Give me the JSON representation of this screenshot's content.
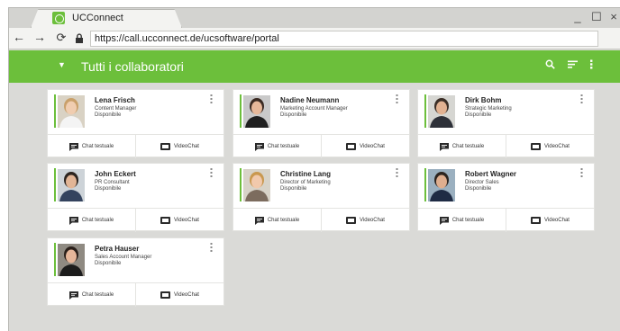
{
  "browser": {
    "tab_title": "UCConnect",
    "url": "https://call.ucconnect.de/ucsoftware/portal",
    "controls": {
      "minimize": "_",
      "maximize": "☐",
      "close": "×"
    },
    "nav": {
      "back": "←",
      "forward": "→",
      "reload": "⟳"
    }
  },
  "appbar": {
    "title": "Tutti i collaboratori",
    "color": "#6cbf3b",
    "icons": [
      "search-icon",
      "filter-icon",
      "more-vertical-icon"
    ]
  },
  "contacts": [
    {
      "name": "Lena Frisch",
      "role": "Content Manager",
      "status": "Disponibile",
      "chat_label": "Chat testuale",
      "video_label": "VideoChat"
    },
    {
      "name": "Nadine Neumann",
      "role": "Marketing Account Manager",
      "status": "Disponibile",
      "chat_label": "Chat testuale",
      "video_label": "VideoChat"
    },
    {
      "name": "Dirk Bohm",
      "role": "Strategic Marketing",
      "status": "Disponibile",
      "chat_label": "Chat testuale",
      "video_label": "VideoChat"
    },
    {
      "name": "John Eckert",
      "role": "PR Consultant",
      "status": "Disponibile",
      "chat_label": "Chat testuale",
      "video_label": "VideoChat"
    },
    {
      "name": "Christine Lang",
      "role": "Director of Marketing",
      "status": "Disponibile",
      "chat_label": "Chat testuale",
      "video_label": "VideoChat"
    },
    {
      "name": "Robert Wagner",
      "role": "Director Sales",
      "status": "Disponibile",
      "chat_label": "Chat testuale",
      "video_label": "VideoChat"
    },
    {
      "name": "Petra Hauser",
      "role": "Sales Account Manager",
      "status": "Disponibile",
      "chat_label": "Chat testuale",
      "video_label": "VideoChat"
    }
  ]
}
